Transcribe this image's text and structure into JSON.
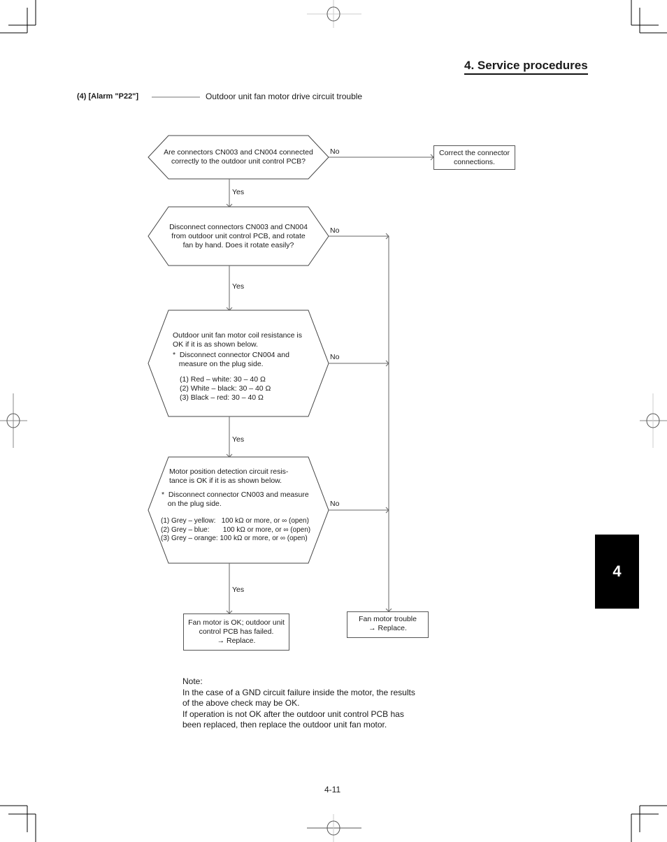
{
  "header": {
    "section_title": "4. Service procedures"
  },
  "alarm": {
    "label": "(4) [Alarm \"P22\"]",
    "description": "Outdoor unit fan motor drive circuit trouble"
  },
  "flowchart": {
    "decisions": [
      {
        "lines": [
          "Are connectors CN003 and CN004 connected",
          "correctly to the outdoor unit control PCB?"
        ],
        "no_label": "No",
        "yes_label": "Yes"
      },
      {
        "lines": [
          "Disconnect connectors CN003 and CN004",
          "from outdoor unit control PCB, and rotate",
          "fan by hand. Does it rotate easily?"
        ],
        "no_label": "No",
        "yes_label": "Yes"
      },
      {
        "intro": [
          "Outdoor unit fan motor coil resistance is",
          "OK if it is as shown below."
        ],
        "instruction": [
          "*  Disconnect connector CN004 and",
          "   measure on the plug side."
        ],
        "checks": [
          "(1) Red – white:  30 – 40 Ω",
          "(2) White – black: 30 – 40 Ω",
          "(3) Black – red: 30 – 40 Ω"
        ],
        "no_label": "No",
        "yes_label": "Yes"
      },
      {
        "intro": [
          "Motor position detection circuit resis-",
          "tance is OK if it is as shown below."
        ],
        "instruction": [
          "*  Disconnect connector CN003 and measure",
          "   on the plug side."
        ],
        "checks": [
          "(1) Grey – yellow:   100 kΩ or more, or ∞ (open)",
          "(2) Grey – blue:       100 kΩ or more, or ∞ (open)",
          "(3) Grey – orange: 100 kΩ or more, or ∞ (open)"
        ],
        "no_label": "No",
        "yes_label": "Yes"
      }
    ],
    "results": {
      "correct_connectors": [
        "Correct the connector",
        "connections."
      ],
      "pcb_failed": [
        "Fan motor is OK; outdoor unit",
        "control PCB has failed.",
        "→ Replace."
      ],
      "motor_trouble": [
        "Fan motor trouble",
        "→ Replace."
      ]
    }
  },
  "note": {
    "heading": "Note:",
    "lines": [
      "In the case of a GND circuit failure inside the motor, the results",
      "of the above check may be OK.",
      "If operation is not OK after the outdoor unit control PCB has",
      "been replaced, then replace the outdoor unit fan motor."
    ]
  },
  "footer": {
    "page_number": "4-11"
  },
  "chapter_tab": {
    "label": "4"
  }
}
